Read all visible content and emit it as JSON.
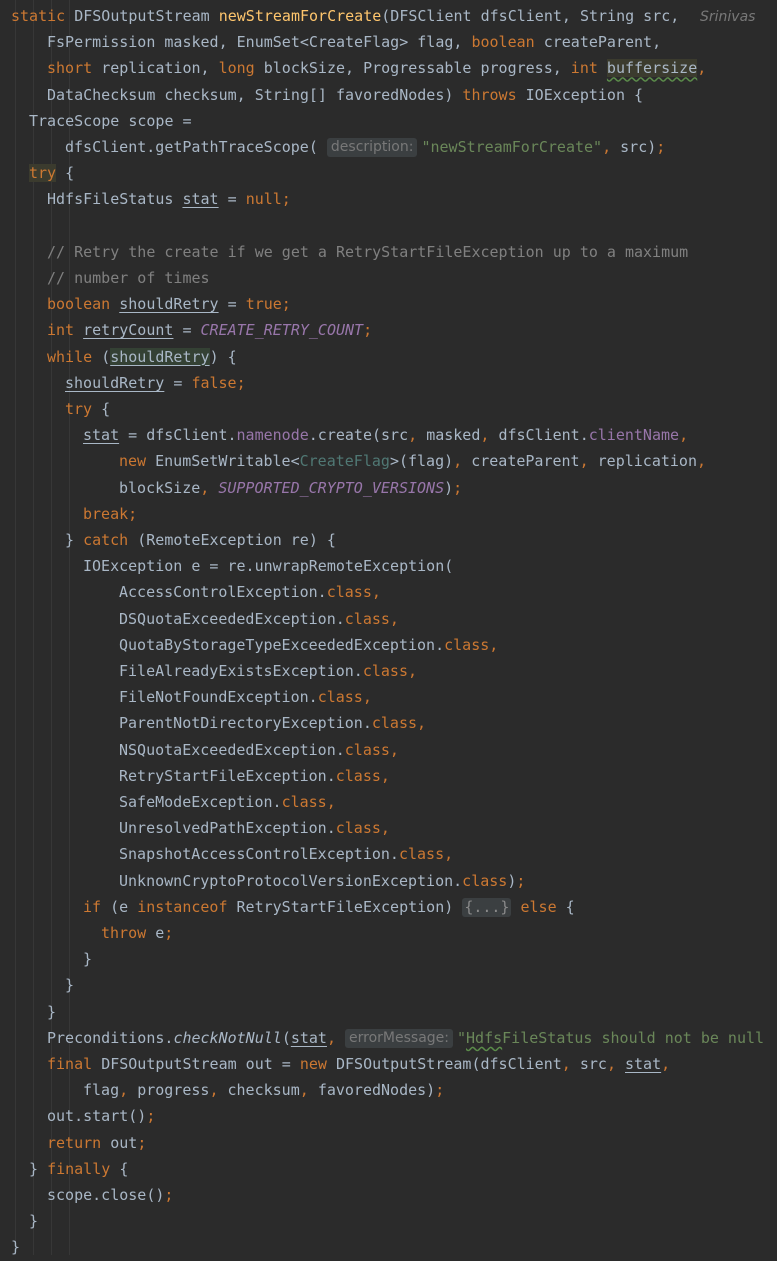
{
  "editor": {
    "author_hint": "Srinivas",
    "lines": [
      [
        [
          "kw",
          "static "
        ],
        [
          "",
          "DFSOutputStream "
        ],
        [
          "fn",
          "newStreamForCreate"
        ],
        [
          "",
          "(DFSClient dfsClient, String src,"
        ]
      ],
      [
        [
          "",
          "FsPermission masked, EnumSet<CreateFlag> flag, "
        ],
        [
          "kw",
          "boolean "
        ],
        [
          "",
          "createParent,"
        ]
      ],
      [
        [
          "kw",
          "short "
        ],
        [
          "",
          "replication, "
        ],
        [
          "kw",
          "long "
        ],
        [
          "",
          "blockSize, Progressable progress, "
        ],
        [
          "kw",
          "int "
        ],
        [
          "hlw wavy",
          "buffersize"
        ],
        [
          "kw",
          ","
        ]
      ],
      [
        [
          "",
          "DataChecksum checksum, String[] favoredNodes) "
        ],
        [
          "kw",
          "throws "
        ],
        [
          "",
          "IOException {"
        ]
      ],
      [
        [
          "",
          "TraceScope scope ="
        ]
      ],
      [
        [
          "",
          "dfsClient.getPathTraceScope( "
        ],
        [
          "hint",
          "description:"
        ],
        [
          "str",
          "\"newStreamForCreate\""
        ],
        [
          "kw",
          ", "
        ],
        [
          "",
          "src)"
        ],
        [
          "kw",
          ";"
        ]
      ],
      [
        [
          "kw hlw",
          "try"
        ],
        [
          "",
          " {"
        ]
      ],
      [
        [
          "",
          "HdfsFileStatus "
        ],
        [
          "u",
          "stat"
        ],
        [
          "",
          ""
        ],
        [
          "",
          " = "
        ],
        [
          "kw",
          "null;"
        ]
      ],
      [],
      [
        [
          "cm",
          "// Retry the create if we get a RetryStartFileException up to a maximum"
        ]
      ],
      [
        [
          "cm",
          "// number of times"
        ]
      ],
      [
        [
          "kw",
          "boolean "
        ],
        [
          "u",
          "shouldRetry"
        ],
        [
          "",
          " = "
        ],
        [
          "kw",
          "true;"
        ]
      ],
      [
        [
          "kw",
          "int "
        ],
        [
          "u",
          "retryCount"
        ],
        [
          "",
          " = "
        ],
        [
          "cst",
          "CREATE_RETRY_COUNT"
        ],
        [
          "kw",
          ";"
        ]
      ],
      [
        [
          "kw",
          "while "
        ],
        [
          "",
          "("
        ],
        [
          "u hl",
          "shouldRetry"
        ],
        [
          "",
          ") {"
        ]
      ],
      [
        [
          "u",
          "shouldRetry"
        ],
        [
          "",
          " = "
        ],
        [
          "kw",
          "false;"
        ]
      ],
      [
        [
          "kw",
          "try "
        ],
        [
          "",
          "{"
        ]
      ],
      [
        [
          "u",
          "stat"
        ],
        [
          "",
          " = dfsClient."
        ],
        [
          "fld",
          "namenode"
        ],
        [
          "",
          ".create(src"
        ],
        [
          "kw",
          ", "
        ],
        [
          "",
          "masked"
        ],
        [
          "kw",
          ", "
        ],
        [
          "",
          "dfsClient."
        ],
        [
          "fld",
          "clientName"
        ],
        [
          "kw",
          ","
        ]
      ],
      [
        [
          "kw",
          "new "
        ],
        [
          "",
          "EnumSetWritable<"
        ],
        [
          "gen",
          "CreateFlag"
        ],
        [
          "",
          ">(flag)"
        ],
        [
          "kw",
          ", "
        ],
        [
          "",
          "createParent"
        ],
        [
          "kw",
          ", "
        ],
        [
          "",
          "replication"
        ],
        [
          "kw",
          ","
        ]
      ],
      [
        [
          "",
          "blockSize"
        ],
        [
          "kw",
          ", "
        ],
        [
          "cst",
          "SUPPORTED_CRYPTO_VERSIONS"
        ],
        [
          "",
          ")"
        ],
        [
          "kw",
          ";"
        ]
      ],
      [
        [
          "kw",
          "break;"
        ]
      ],
      [
        [
          "",
          "} "
        ],
        [
          "kw",
          "catch "
        ],
        [
          "",
          "(RemoteException re) {"
        ]
      ],
      [
        [
          "",
          "IOException e = re.unwrapRemoteException("
        ]
      ],
      [
        [
          "",
          "AccessControlException."
        ],
        [
          "kw",
          "class,"
        ]
      ],
      [
        [
          "",
          "DSQuotaExceededException."
        ],
        [
          "kw",
          "class,"
        ]
      ],
      [
        [
          "",
          "QuotaByStorageTypeExceededException."
        ],
        [
          "kw",
          "class,"
        ]
      ],
      [
        [
          "",
          "FileAlreadyExistsException."
        ],
        [
          "kw",
          "class,"
        ]
      ],
      [
        [
          "",
          "FileNotFoundException."
        ],
        [
          "kw",
          "class,"
        ]
      ],
      [
        [
          "",
          "ParentNotDirectoryException."
        ],
        [
          "kw",
          "class,"
        ]
      ],
      [
        [
          "",
          "NSQuotaExceededException."
        ],
        [
          "kw",
          "class,"
        ]
      ],
      [
        [
          "",
          "RetryStartFileException."
        ],
        [
          "kw",
          "class,"
        ]
      ],
      [
        [
          "",
          "SafeModeException."
        ],
        [
          "kw",
          "class,"
        ]
      ],
      [
        [
          "",
          "UnresolvedPathException."
        ],
        [
          "kw",
          "class,"
        ]
      ],
      [
        [
          "",
          "SnapshotAccessControlException."
        ],
        [
          "kw",
          "class,"
        ]
      ],
      [
        [
          "",
          "UnknownCryptoProtocolVersionException."
        ],
        [
          "kw",
          "class"
        ],
        [
          "",
          ")"
        ],
        [
          "kw",
          ";"
        ]
      ],
      [
        [
          "kw",
          "if "
        ],
        [
          "",
          "(e "
        ],
        [
          "kw",
          "instanceof "
        ],
        [
          "",
          "RetryStartFileException) "
        ],
        [
          "fold",
          "{...}"
        ],
        [
          "kw",
          " else "
        ],
        [
          "",
          "{"
        ]
      ],
      [
        [
          "kw",
          "throw "
        ],
        [
          "",
          "e"
        ],
        [
          "kw",
          ";"
        ]
      ],
      [
        [
          "",
          "}"
        ]
      ],
      [
        [
          "",
          "}"
        ]
      ],
      [
        [
          "",
          "}"
        ]
      ],
      [
        [
          "",
          "Preconditions."
        ],
        [
          "stat",
          "checkNotNull"
        ],
        [
          "",
          "("
        ],
        [
          "u",
          "stat"
        ],
        [
          "kw",
          ", "
        ],
        [
          "hint",
          "errorMessage:"
        ],
        [
          "str",
          "\""
        ],
        [
          "str wavy",
          "Hdfs"
        ],
        [
          "str",
          "FileStatus should not be null"
        ]
      ],
      [
        [
          "kw",
          "final "
        ],
        [
          "",
          "DFSOutputStream out = "
        ],
        [
          "kw",
          "new "
        ],
        [
          "",
          "DFSOutputStream(dfsClient"
        ],
        [
          "kw",
          ", "
        ],
        [
          "",
          "src"
        ],
        [
          "kw",
          ", "
        ],
        [
          "u",
          "stat"
        ],
        [
          "kw",
          ","
        ]
      ],
      [
        [
          "",
          "flag"
        ],
        [
          "kw",
          ", "
        ],
        [
          "",
          "progress"
        ],
        [
          "kw",
          ", "
        ],
        [
          "",
          "checksum"
        ],
        [
          "kw",
          ", "
        ],
        [
          "",
          "favoredNodes)"
        ],
        [
          "kw",
          ";"
        ]
      ],
      [
        [
          "",
          "out.start()"
        ],
        [
          "kw",
          ";"
        ]
      ],
      [
        [
          "kw",
          "return "
        ],
        [
          "",
          "out"
        ],
        [
          "kw",
          ";"
        ]
      ],
      [
        [
          "",
          "} "
        ],
        [
          "kw",
          "finally "
        ],
        [
          "",
          "{"
        ]
      ],
      [
        [
          "",
          "scope.close()"
        ],
        [
          "kw",
          ";"
        ]
      ],
      [
        [
          "",
          "}"
        ]
      ],
      [
        [
          "",
          "}"
        ]
      ]
    ]
  }
}
